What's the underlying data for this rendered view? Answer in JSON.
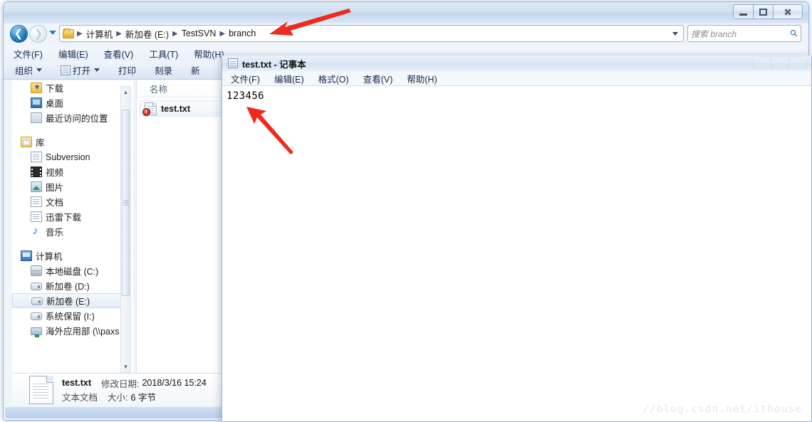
{
  "window": {
    "controls": {
      "minimize": "—",
      "maximize": "□",
      "close": "✕"
    }
  },
  "addressbar": {
    "back_glyph": "←",
    "forward_glyph": "→",
    "crumbs": [
      "计算机",
      "新加卷 (E:)",
      "TestSVN",
      "branch"
    ],
    "separator": "▶",
    "refresh_glyph": "↻"
  },
  "search": {
    "placeholder": "搜索 branch",
    "icon_glyph": "⚲"
  },
  "menubar": {
    "items": [
      "文件(F)",
      "编辑(E)",
      "查看(V)",
      "工具(T)",
      "帮助(H)"
    ]
  },
  "toolbar": {
    "organize": "组织",
    "open": "打开",
    "print": "打印",
    "burn": "刻录",
    "new": "新"
  },
  "navpane": {
    "groups": [
      {
        "items": [
          {
            "label": "下载",
            "icon": "download-folder-icon",
            "level": 1
          },
          {
            "label": "桌面",
            "icon": "desktop-icon",
            "level": 1
          },
          {
            "label": "最近访问的位置",
            "icon": "recent-places-icon",
            "level": 1
          }
        ]
      },
      {
        "items": [
          {
            "label": "库",
            "icon": "library-icon",
            "level": 0
          },
          {
            "label": "Subversion",
            "icon": "document-icon",
            "level": 1
          },
          {
            "label": "视频",
            "icon": "video-icon",
            "level": 1
          },
          {
            "label": "图片",
            "icon": "pictures-icon",
            "level": 1
          },
          {
            "label": "文档",
            "icon": "documents-icon",
            "level": 1
          },
          {
            "label": "迅雷下载",
            "icon": "thunder-download-icon",
            "level": 1
          },
          {
            "label": "音乐",
            "icon": "music-icon",
            "level": 1
          }
        ]
      },
      {
        "items": [
          {
            "label": "计算机",
            "icon": "computer-icon",
            "level": 0
          },
          {
            "label": "本地磁盘 (C:)",
            "icon": "harddisk-icon",
            "level": 1
          },
          {
            "label": "新加卷 (D:)",
            "icon": "drive-icon",
            "level": 1
          },
          {
            "label": "新加卷 (E:)",
            "icon": "drive-icon",
            "level": 1,
            "selected": true
          },
          {
            "label": "系统保留 (I:)",
            "icon": "drive-icon",
            "level": 1
          },
          {
            "label": "海外应用部 (\\\\paxs",
            "icon": "network-drive-icon",
            "level": 1
          }
        ]
      }
    ],
    "scroll": {
      "up_glyph": "▲",
      "down_glyph": "▼"
    }
  },
  "filelist": {
    "columns": [
      "名称"
    ],
    "rows": [
      {
        "name": "test.txt",
        "icon": "text-file-icon",
        "badge": "svn-modified-badge",
        "selected": true
      }
    ]
  },
  "details": {
    "filename": "test.txt",
    "modified_label": "修改日期:",
    "modified_value": "2018/3/16 15:24",
    "type": "文本文档",
    "size_label": "大小:",
    "size_value": "6 字节"
  },
  "notepad": {
    "title": "test.txt - 记事本",
    "menu": [
      "文件(F)",
      "编辑(E)",
      "格式(O)",
      "查看(V)",
      "帮助(H)"
    ],
    "content": "123456"
  },
  "annotations": {
    "arrow_color": "#ee2a1e",
    "arrow1_target": "branch",
    "arrow2_target": "123456"
  },
  "watermark": {
    "text": "//blog.csdn.net/ithouse"
  },
  "colors": {
    "accent": "#2a7fc0",
    "arrow_red": "#ee2a1e",
    "badge_red": "#c41f12",
    "caption_blue": "#cfe0f2"
  }
}
